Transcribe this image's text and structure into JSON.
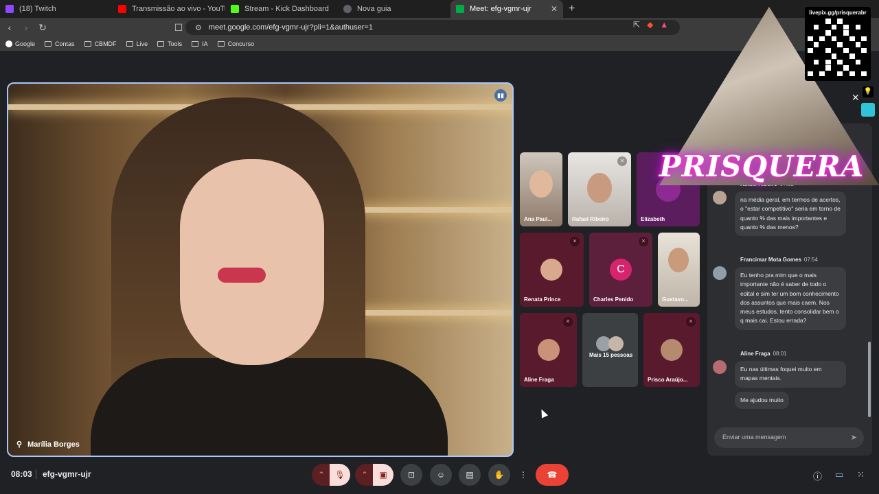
{
  "browser": {
    "tabs": [
      {
        "label": "(18) Twitch",
        "color": "#9146ff"
      },
      {
        "label": "Transmissão ao vivo - YouTube Studio",
        "color": "#ff0000"
      },
      {
        "label": "Stream - Kick Dashboard",
        "color": "#53fc18"
      },
      {
        "label": "Nova guia",
        "color": "#9aa0a6"
      },
      {
        "label": "Meet: efg-vgmr-ujr",
        "color": "#00ac47"
      }
    ],
    "new_tab": "+",
    "url": "meet.google.com/efg-vgmr-ujr?pli=1&authuser=1",
    "bookmarks": [
      "Google",
      "Contas",
      "CBMDF",
      "Live",
      "Tools",
      "IA",
      "Concurso"
    ]
  },
  "main_video": {
    "name": "Marília Borges"
  },
  "tiles": [
    {
      "name": "Ana Paul..."
    },
    {
      "name": "Rafael Ribeiro"
    },
    {
      "name": "Elizabeth"
    },
    {
      "name": "Renata Prince"
    },
    {
      "name": "Charles Penido",
      "initial": "C"
    },
    {
      "name": "Gustavo..."
    },
    {
      "name": "Aline Fraga"
    },
    {
      "name": "Mais 15 pessoas"
    },
    {
      "name": "Prisco Araújo..."
    }
  ],
  "overlay": {
    "brand": "PRISQUERA",
    "qr_label": "livepix.gg/prisquerabr"
  },
  "chat": {
    "messages": [
      {
        "author": "Rafael Ribeiro",
        "time": "07:52",
        "texts": [
          "na média geral, em termos de acertos, o \"estar competitivo\" seria em torno de quanto % das mais importantes e quanto % das menos?"
        ]
      },
      {
        "author": "Francimar Mota Gomes",
        "time": "07:54",
        "texts": [
          "Eu tenho pra mim que o mais importante não é saber de todo o edital e sim ter um bom conhecimento dos assuntos que mais caem. Nos meus estudos, tento consolidar bem o q mais cai. Estou errada?"
        ]
      },
      {
        "author": "Aline Fraga",
        "time": "08:01",
        "texts": [
          "Eu nas últimas foquei muito em mapas mentais.",
          "Me ajudou muito"
        ]
      }
    ],
    "input_placeholder": "Enviar uma mensagem"
  },
  "bottom": {
    "time": "08:03",
    "meeting_code": "efg-vgmr-ujr"
  },
  "colors": {
    "accent": "#a8c7fa",
    "hangup": "#ea4335",
    "muted_bg": "#f9dedc"
  }
}
